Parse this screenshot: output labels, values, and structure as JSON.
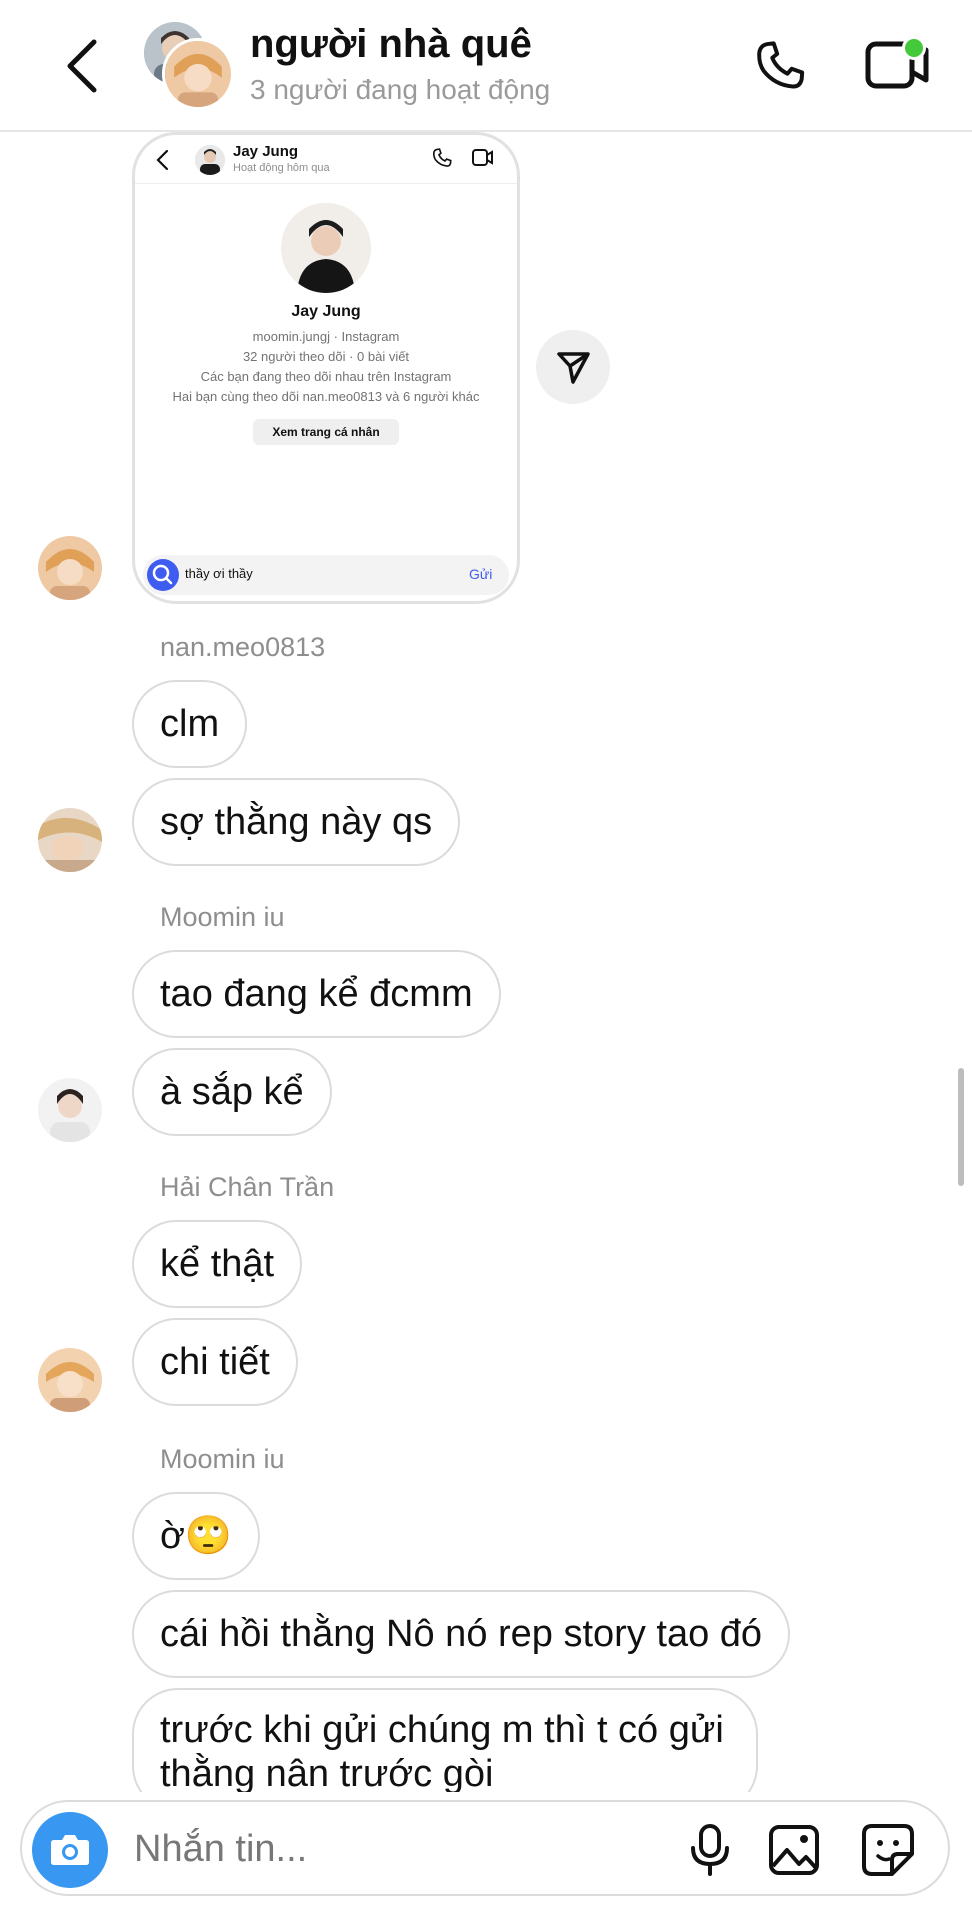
{
  "header": {
    "title": "người nhà quê",
    "subtitle": "3 người đang hoạt động"
  },
  "shared_card": {
    "name": "Jay Jung",
    "status": "Hoạt động hôm qua",
    "profile_name": "Jay Jung",
    "handle": "moomin.jungj · Instagram",
    "stats": "32 người theo dõi · 0 bài viết",
    "mutual_line1": "Các bạn đang theo dõi nhau trên Instagram",
    "mutual_line2": "Hai bạn cùng theo dõi nan.meo0813 và 6 người khác",
    "view_profile_label": "Xem trang cá nhân",
    "input_value": "thầy ơi thầy",
    "send_label": "Gửi"
  },
  "messages": [
    {
      "sender": "nan.meo0813",
      "bubbles": [
        "clm",
        "sợ thằng này qs"
      ]
    },
    {
      "sender": "Moomin iu",
      "bubbles": [
        "tao đang kể đcmm",
        "à sắp kể"
      ]
    },
    {
      "sender": "Hải Chân Trần",
      "bubbles": [
        "kể thật",
        "chi tiết"
      ]
    },
    {
      "sender": "Moomin iu",
      "bubbles": [
        "ờ🙄",
        "cái hồi thằng Nô nó rep story tao đó",
        "trước khi gửi chúng m thì t có gửi thằng nân trước gòi"
      ]
    }
  ],
  "composer": {
    "placeholder": "Nhắn tin..."
  },
  "icons": {
    "back": "chevron-left-icon",
    "call": "phone-icon",
    "video": "video-camera-icon",
    "forward": "paper-plane-icon",
    "camera": "camera-icon",
    "mic": "microphone-icon",
    "gallery": "image-icon",
    "sticker": "sticker-icon"
  },
  "colors": {
    "accent": "#3897f0",
    "online": "#44c93b",
    "meta_text": "#8e8e8e"
  }
}
